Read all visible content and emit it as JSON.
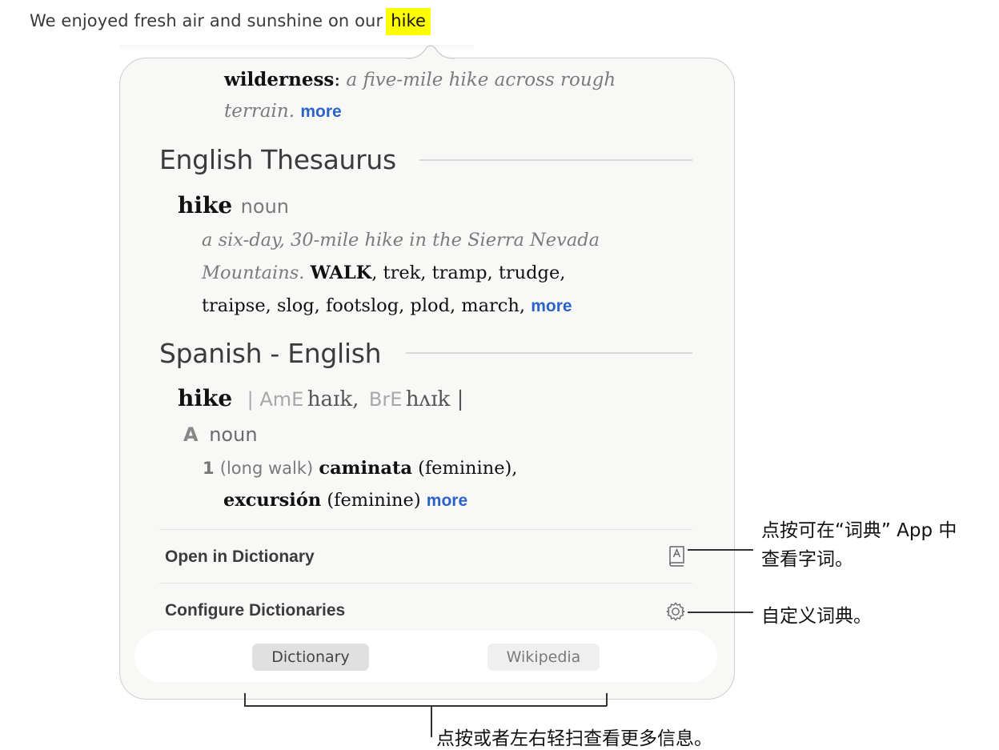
{
  "sentence": {
    "text": "We enjoyed fresh air and sunshine on our",
    "highlighted_word": "hike"
  },
  "top_entry": {
    "term": "wilderness",
    "colon": ":",
    "example_line1": "a five-mile hike across rough",
    "example_line2": "terrain.",
    "more": "more"
  },
  "thesaurus": {
    "title": "English Thesaurus",
    "headword": "hike",
    "pos": "noun",
    "example_line1": "a six-day, 30-mile hike in the Sierra Nevada",
    "example_line2": "Mountains.",
    "primary_synonym": "WALK",
    "synonyms_line2_rest": ", trek, tramp, trudge,",
    "synonyms_line3": "traipse, slog, footslog, plod, march,",
    "more": "more"
  },
  "spanish": {
    "title": "Spanish - English",
    "headword": "hike",
    "pron_open": "| AmE",
    "pron_ame": "haɪk,",
    "pron_bre_label": "BrE",
    "pron_bre": "hʌɪk |",
    "sense_letter": "A",
    "sense_pos": "noun",
    "sense_num": "1",
    "sense_context": "(long walk)",
    "translation1": "caminata",
    "translation1_gender": "(feminine),",
    "translation2": "excursión",
    "translation2_gender": "(feminine)",
    "more": "more"
  },
  "actions": {
    "open_dictionary": "Open in Dictionary",
    "configure": "Configure Dictionaries"
  },
  "tabs": {
    "dictionary": "Dictionary",
    "wikipedia": "Wikipedia",
    "selected": "Dictionary"
  },
  "callouts": {
    "open_line1": "点按可在“词典” App 中",
    "open_line2": "查看字词。",
    "configure": "自定义词典。",
    "tabs": "点按或者左右轻扫查看更多信息。"
  },
  "icons": {
    "open_dictionary": "dictionary-book-icon",
    "configure": "gear-icon"
  },
  "colors": {
    "highlight": "#ffff00",
    "link": "#2c63c9",
    "popover_bg": "#f8f8f7"
  }
}
